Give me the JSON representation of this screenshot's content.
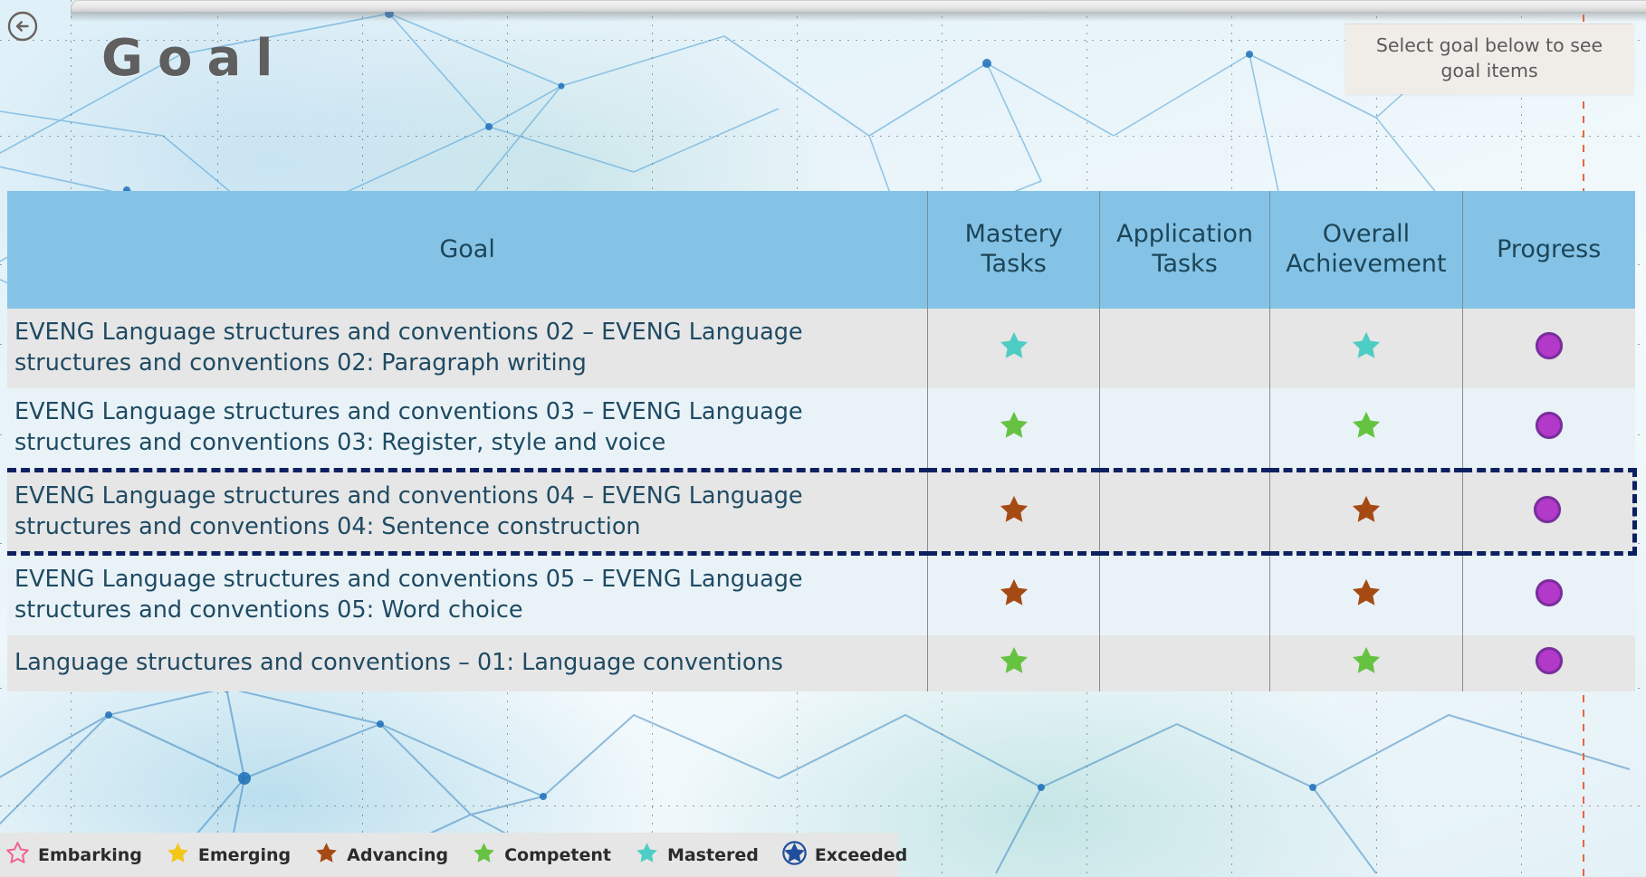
{
  "header": {
    "title": "Goal",
    "back_icon": "back-arrow-icon",
    "hint": "Select goal below to see goal items"
  },
  "table": {
    "columns": [
      {
        "key": "goal",
        "label": "Goal"
      },
      {
        "key": "mastery",
        "label": "Mastery\nTasks"
      },
      {
        "key": "app",
        "label": "Application\nTasks"
      },
      {
        "key": "overall",
        "label": "Overall\nAchievement"
      },
      {
        "key": "progress",
        "label": "Progress"
      }
    ],
    "column_labels": {
      "goal": "Goal",
      "mastery_line1": "Mastery",
      "mastery_line2": "Tasks",
      "application_line1": "Application",
      "application_line2": "Tasks",
      "overall_line1": "Overall",
      "overall_line2": "Achievement",
      "progress": "Progress"
    },
    "rows": [
      {
        "goal_line1": "EVENG Language structures and conventions 02 – EVENG Language",
        "goal_line2": "structures and conventions 02: Paragraph writing",
        "mastery": "Mastered",
        "application": "",
        "overall": "Mastered",
        "progress": "in-progress",
        "selected": false
      },
      {
        "goal_line1": "EVENG Language structures and conventions 03 – EVENG Language",
        "goal_line2": "structures and conventions 03: Register, style and voice",
        "mastery": "Competent",
        "application": "",
        "overall": "Competent",
        "progress": "in-progress",
        "selected": false
      },
      {
        "goal_line1": "EVENG Language structures and conventions 04 – EVENG Language",
        "goal_line2": "structures and conventions 04: Sentence construction",
        "mastery": "Advancing",
        "application": "",
        "overall": "Advancing",
        "progress": "in-progress",
        "selected": true
      },
      {
        "goal_line1": "EVENG Language structures and conventions 05 – EVENG Language",
        "goal_line2": "structures and conventions 05: Word choice",
        "mastery": "Advancing",
        "application": "",
        "overall": "Advancing",
        "progress": "in-progress",
        "selected": false
      },
      {
        "goal_line1": "Language structures and conventions – 01: Language conventions",
        "goal_line2": "",
        "mastery": "Competent",
        "application": "",
        "overall": "Competent",
        "progress": "in-progress",
        "selected": false
      }
    ]
  },
  "legend": {
    "items": [
      {
        "label": "Embarking",
        "color": "#f06292",
        "style": "outline-star"
      },
      {
        "label": "Emerging",
        "color": "#f5c518",
        "style": "filled-star"
      },
      {
        "label": "Advancing",
        "color": "#a64a14",
        "style": "filled-star"
      },
      {
        "label": "Competent",
        "color": "#66c342",
        "style": "filled-star"
      },
      {
        "label": "Mastered",
        "color": "#4ecdc4",
        "style": "filled-star"
      },
      {
        "label": "Exceeded",
        "color": "#1f4e9c",
        "style": "circled-star"
      }
    ]
  },
  "colors": {
    "header_bg": "#84c3e6",
    "row_odd": "#e6e6e6",
    "row_even": "#e9f3f7",
    "selected_border": "#0d2060",
    "progress_fill": "#b339c9",
    "progress_ring": "#7a2d9e",
    "title_text": "#5f5f5f",
    "body_text": "#1f4a63",
    "guide_red": "#e8663c"
  }
}
